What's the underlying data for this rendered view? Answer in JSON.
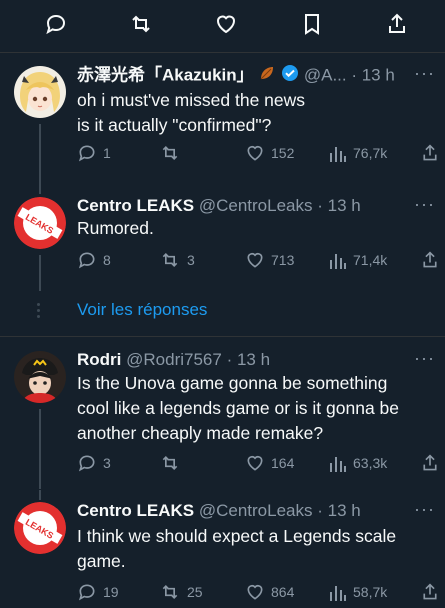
{
  "top_actions": {
    "reply_icon": "reply-icon",
    "retweet_icon": "retweet-icon",
    "like_icon": "heart-icon",
    "bookmark_icon": "bookmark-icon",
    "share_icon": "share-icon"
  },
  "tweets": [
    {
      "name": "赤澤光希「Akazukin」",
      "handle": "@A...",
      "time": "· 13 h",
      "text_lines": [
        "oh i must've missed the news",
        "is it actually \"confirmed\"?"
      ],
      "reply_count": "1",
      "retweet_count": "",
      "like_count": "152",
      "view_count": "76,7k",
      "avatar": "anime-girl-avatar"
    },
    {
      "name": "Centro LEAKS",
      "handle": "@CentroLeaks",
      "time": "· 13 h",
      "text_lines": [
        "Rumored."
      ],
      "reply_count": "8",
      "retweet_count": "3",
      "like_count": "713",
      "view_count": "71,4k",
      "avatar": "centro-leaks-logo"
    },
    {
      "name": "Rodri",
      "handle": "@Rodri7567",
      "time": "· 13 h",
      "text_lines": [
        "Is the Unova game gonna be something",
        "cool like a legends game or is it gonna be",
        "another cheaply made remake?"
      ],
      "reply_count": "3",
      "retweet_count": "",
      "like_count": "164",
      "view_count": "63,3k",
      "avatar": "anime-boy-avatar"
    },
    {
      "name": "Centro LEAKS",
      "handle": "@CentroLeaks",
      "time": "· 13 h",
      "text_lines": [
        "I think we should expect a Legends scale",
        "game."
      ],
      "reply_count": "19",
      "retweet_count": "25",
      "like_count": "864",
      "view_count": "58,7k",
      "avatar": "centro-leaks-logo"
    }
  ],
  "show_replies_label": "Voir les réponses",
  "more_label": "···",
  "colors": {
    "background": "#15202b",
    "text": "#f7f9f9",
    "muted": "#8b98a5",
    "accent": "#1d9bf0",
    "verified": "#1d9bf0"
  }
}
